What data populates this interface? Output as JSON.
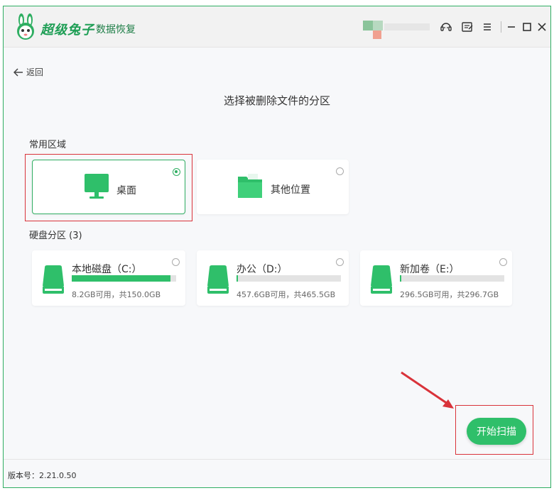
{
  "app": {
    "brand_name": "超级兔子",
    "brand_sub": "数据恢复"
  },
  "titlebar": {
    "icons": [
      "headset-icon",
      "feedback-icon",
      "menu-icon",
      "minimize-icon",
      "maximize-icon",
      "close-icon"
    ]
  },
  "nav": {
    "back_label": "返回"
  },
  "page_title": "选择被删除文件的分区",
  "common_area": {
    "label": "常用区域",
    "items": [
      {
        "label": "桌面",
        "icon": "monitor-icon",
        "selected": true
      },
      {
        "label": "其他位置",
        "icon": "folder-icon",
        "selected": false
      }
    ]
  },
  "disk_partitions": {
    "label": "硬盘分区 (3)",
    "drives": [
      {
        "name": "本地磁盘（C:）",
        "info": "8.2GB可用，共150.0GB",
        "used_fraction": 0.945,
        "selected": false
      },
      {
        "name": "办公（D:）",
        "info": "457.6GB可用，共465.5GB",
        "used_fraction": 0.017,
        "selected": false
      },
      {
        "name": "新加卷（E:）",
        "info": "296.5GB可用，共296.7GB",
        "used_fraction": 0.001,
        "selected": false
      }
    ]
  },
  "actions": {
    "start_scan_label": "开始扫描"
  },
  "status": {
    "version_label": "版本号：2.21.0.50"
  },
  "colors": {
    "accent": "#2fbf6a",
    "annotation_red": "#d9333a"
  }
}
